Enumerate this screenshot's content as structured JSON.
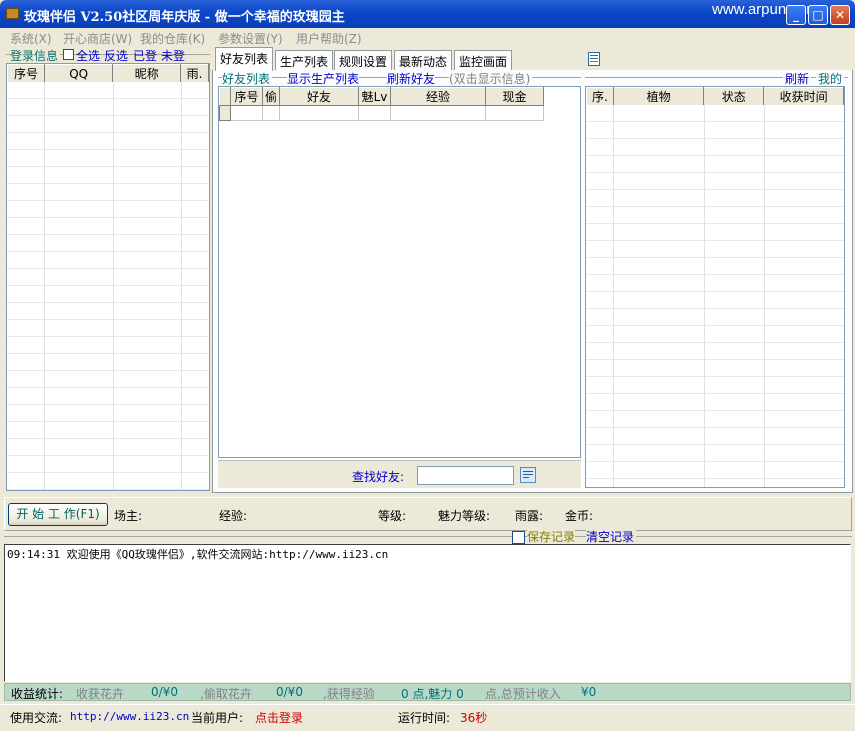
{
  "window": {
    "title": "玫瑰伴侣 V2.50社区周年庆版 - 做一个幸福的玫瑰园主",
    "watermark": "www.arpun.com"
  },
  "menu": [
    "系统(X)",
    "开心商店(W)",
    "我的仓库(K)",
    "参数设置(Y)",
    "用户帮助(Z)"
  ],
  "left_panel": {
    "group_label": "登录信息",
    "select_all": "全选",
    "invert": "反选",
    "logged_in": "已登",
    "not_logged_in": "未登",
    "columns": [
      "序号",
      "QQ",
      "昵称",
      "雨."
    ]
  },
  "tabs": [
    "好友列表",
    "生产列表",
    "规则设置",
    "最新动态",
    "监控画面"
  ],
  "friends": {
    "group_label": "好友列表",
    "show_production": "显示生产列表",
    "refresh_friends": "刷新好友",
    "hint": "(双击显示信息)",
    "columns": [
      "序号",
      "偷",
      "好友",
      "魅Lv",
      "经验",
      "现金"
    ],
    "search_label": "查找好友:",
    "search_value": ""
  },
  "mine": {
    "refresh": "刷新",
    "mine_label": "我的",
    "columns": [
      "序.",
      "植物",
      "状态",
      "收获时间"
    ]
  },
  "status": {
    "start_button": "开 始 工 作(F1)",
    "owner": "场主:",
    "exp": "经验:",
    "level": "等级:",
    "charm_level": "魅力等级:",
    "rain": "雨露:",
    "gold": "金币:"
  },
  "log": {
    "save_record": "保存记录",
    "clear_record": "清空记录",
    "entry": "09:14:31 欢迎使用《QQ玫瑰伴侣》,软件交流网站:http://www.ii23.cn"
  },
  "income": {
    "label": "收益统计:",
    "harvest_label": "收获花卉",
    "harvest_value": "0/¥0",
    "steal_label": ",偷取花卉",
    "steal_value": "0/¥0",
    "exp_label": ",获得经验",
    "exp_value": "0 点,魅力 0",
    "total_label": "点,总预计收入",
    "total_value": "¥0"
  },
  "footer": {
    "exchange_label": "使用交流:",
    "exchange_url": "http://www.ii23.cn",
    "current_user_label": "当前用户:",
    "current_user_value": "点击登录",
    "runtime_label": "运行时间:",
    "runtime_value": "36秒"
  },
  "colors": {
    "title_bar": "#0a46c8",
    "link": "#0000cc",
    "alert_red": "#cc0000",
    "group_green": "#007070",
    "income_bar": "#b9d8c7"
  }
}
